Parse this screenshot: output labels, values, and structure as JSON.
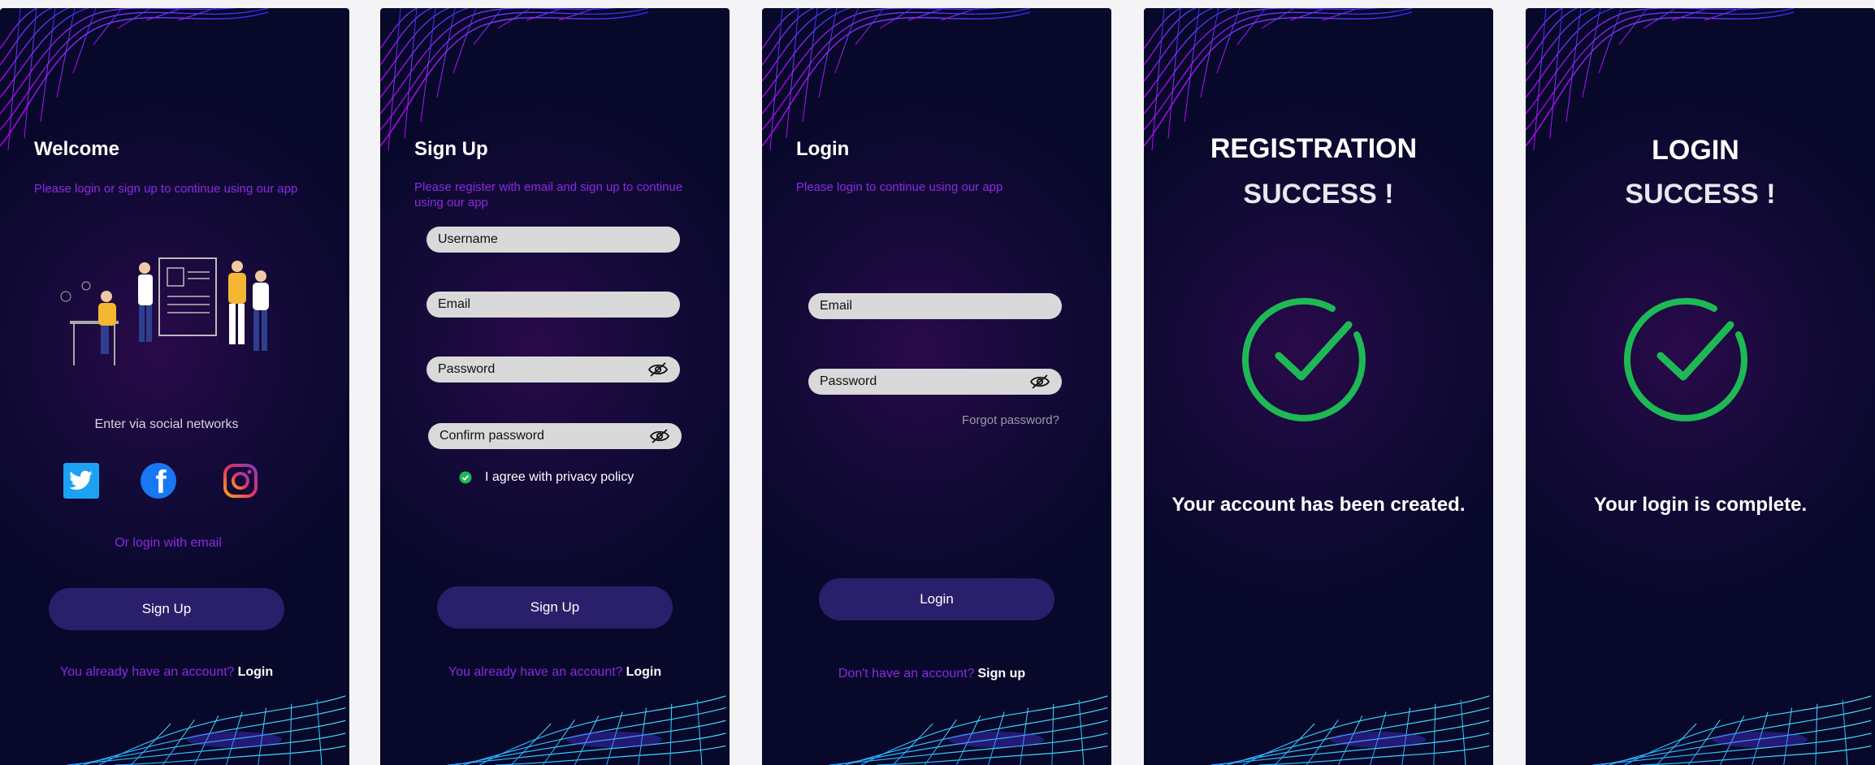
{
  "welcome": {
    "title": "Welcome",
    "subtitle": "Please login or sign up to continue using our app",
    "social_label": "Enter via social networks",
    "social": [
      "twitter-icon",
      "facebook-icon",
      "instagram-icon"
    ],
    "email_link": "Or login with email",
    "button": "Sign Up",
    "footer_question": "You already have an account?",
    "footer_action": "Login"
  },
  "signup": {
    "title": "Sign Up",
    "subtitle": "Please register with email and sign up to continue using our app",
    "username_placeholder": "Username",
    "email_placeholder": "Email",
    "password_placeholder": "Password",
    "confirm_placeholder": "Confirm password",
    "agree_label": "I agree with privacy policy",
    "agree_checked": true,
    "button": "Sign Up",
    "footer_question": "You already have an account?",
    "footer_action": "Login"
  },
  "login": {
    "title": "Login",
    "subtitle": "Please login to continue using our app",
    "email_placeholder": "Email",
    "password_placeholder": "Password",
    "forgot": "Forgot password?",
    "button": "Login",
    "footer_question": "Don't have an account?",
    "footer_action": "Sign up"
  },
  "registration_success": {
    "line1": "REGISTRATION",
    "line2": "SUCCESS !",
    "message": "Your account has been created."
  },
  "login_success": {
    "line1": "LOGIN",
    "line2": "SUCCESS !",
    "message": "Your login is complete."
  },
  "colors": {
    "accent_purple": "#8a2be2",
    "button_bg": "#2a1f6b",
    "success_green": "#1db954",
    "field_bg": "#d9d9d9"
  }
}
